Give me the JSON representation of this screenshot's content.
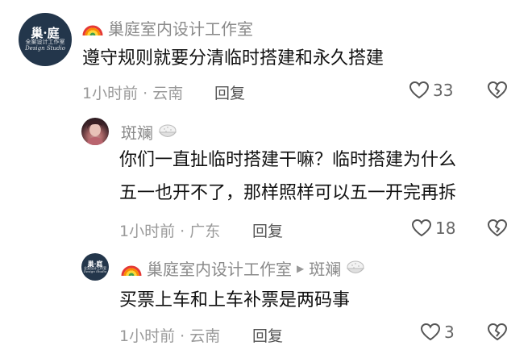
{
  "colors": {
    "logo_bg": "#23364b",
    "meta_gray": "#9a9a9a",
    "name_gray": "#8a8a8a"
  },
  "comments": [
    {
      "logo": {
        "l1": "巢·庭",
        "l2": "全案设计工作室",
        "l3": "Design Studio"
      },
      "name": "巢庭室内设计工作室",
      "text_lines": [
        "遵守规则就要分清临时搭建和永久搭建"
      ],
      "meta": "1小时前 · 云南",
      "reply": "回复",
      "likes": "33"
    },
    {
      "name": "斑斓",
      "text_lines": [
        "你们一直扯临时搭建干嘛？临时搭建为什么",
        "五一也开不了，那样照样可以五一开完再拆"
      ],
      "meta": "1小时前 · 广东",
      "reply": "回复",
      "likes": "18"
    },
    {
      "logo": {
        "l1": "巢·庭",
        "l2": "全案设计工作室",
        "l3": "Design Studio"
      },
      "name": "巢庭室内设计工作室",
      "reply_to": "斑斓",
      "text_lines": [
        "买票上车和上车补票是两码事"
      ],
      "meta": "1小时前 · 云南",
      "reply": "回复",
      "likes": "3"
    }
  ]
}
